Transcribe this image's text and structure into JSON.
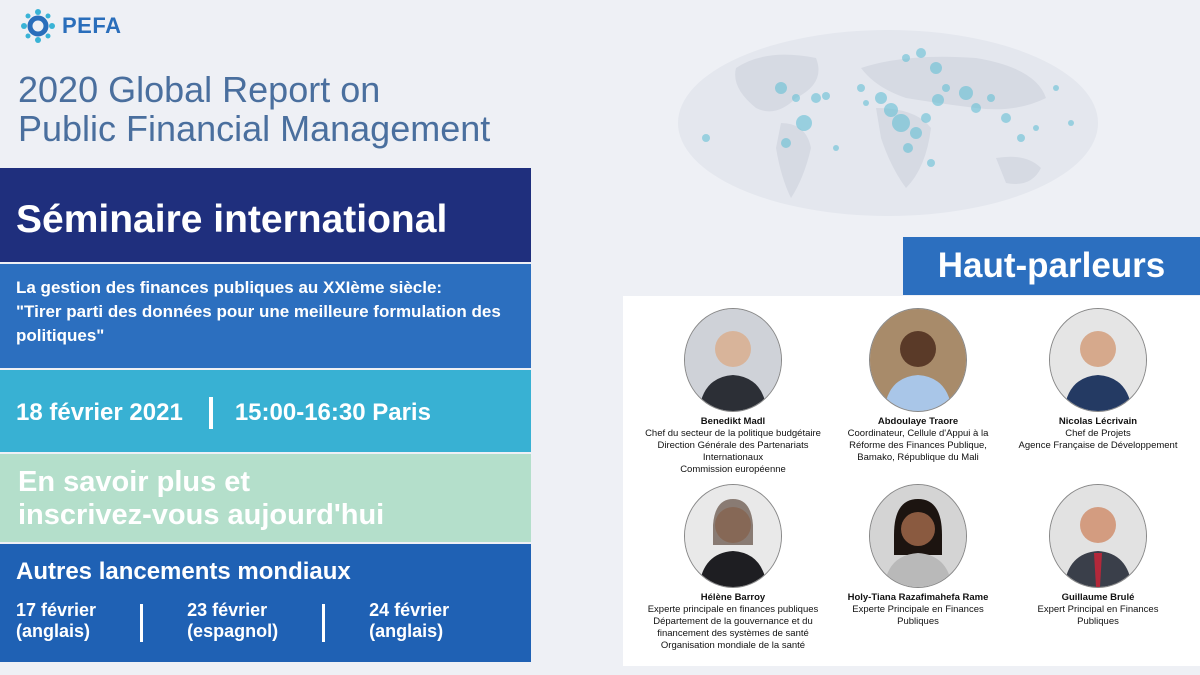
{
  "brand": {
    "name": "PEFA"
  },
  "report_title": {
    "line1": "2020 Global Report on",
    "line2": "Public Financial Management"
  },
  "seminar": {
    "title": "Séminaire international"
  },
  "topic": {
    "line1": "La gestion des finances publiques au XXIème siècle:",
    "line2": "\"Tirer parti des données pour une meilleure formulation des politiques\""
  },
  "event": {
    "date": "18 février 2021",
    "time": "15:00-16:30 Paris"
  },
  "register": {
    "line1": "En savoir plus et",
    "line2": "inscrivez-vous aujourd'hui"
  },
  "other_launches": {
    "title": "Autres lancements mondiaux",
    "items": [
      {
        "date": "17 février",
        "lang": "(anglais)"
      },
      {
        "date": "23 février",
        "lang": "(espagnol)"
      },
      {
        "date": "24 février",
        "lang": "(anglais)"
      }
    ]
  },
  "speakers_title": "Haut-parleurs",
  "speakers": [
    {
      "name": "Benedikt Madl",
      "lines": [
        "Chef du secteur de la politique budgétaire",
        "Direction Générale des Partenariats",
        "Internationaux",
        "Commission européenne"
      ]
    },
    {
      "name": "Abdoulaye Traore",
      "lines": [
        "Coordinateur, Cellule d'Appui à la",
        "Réforme des Finances Publique,",
        "Bamako, République du Mali"
      ]
    },
    {
      "name": "Nicolas Lécrivain",
      "lines": [
        "Chef de Projets",
        "Agence Française de Développement"
      ]
    },
    {
      "name": "Hélène Barroy",
      "lines": [
        "Experte principale en finances publiques",
        "Département de la gouvernance et du",
        "financement des systèmes de santé",
        "Organisation mondiale de la santé"
      ]
    },
    {
      "name": "Holy-Tiana Razafimahefa Rame",
      "lines": [
        "Experte Principale en Finances",
        "Publiques"
      ]
    },
    {
      "name": "Guillaume Brulé",
      "lines": [
        "Expert Principal en Finances",
        "Publiques"
      ]
    }
  ],
  "colors": {
    "navy": "#1f2f7d",
    "blue": "#2c6fbf",
    "cyan": "#38b1d3",
    "mint": "#b4dfcb",
    "royal": "#1f61b4",
    "title_text": "#4a6f9e",
    "brand": "#2a6ebb"
  }
}
